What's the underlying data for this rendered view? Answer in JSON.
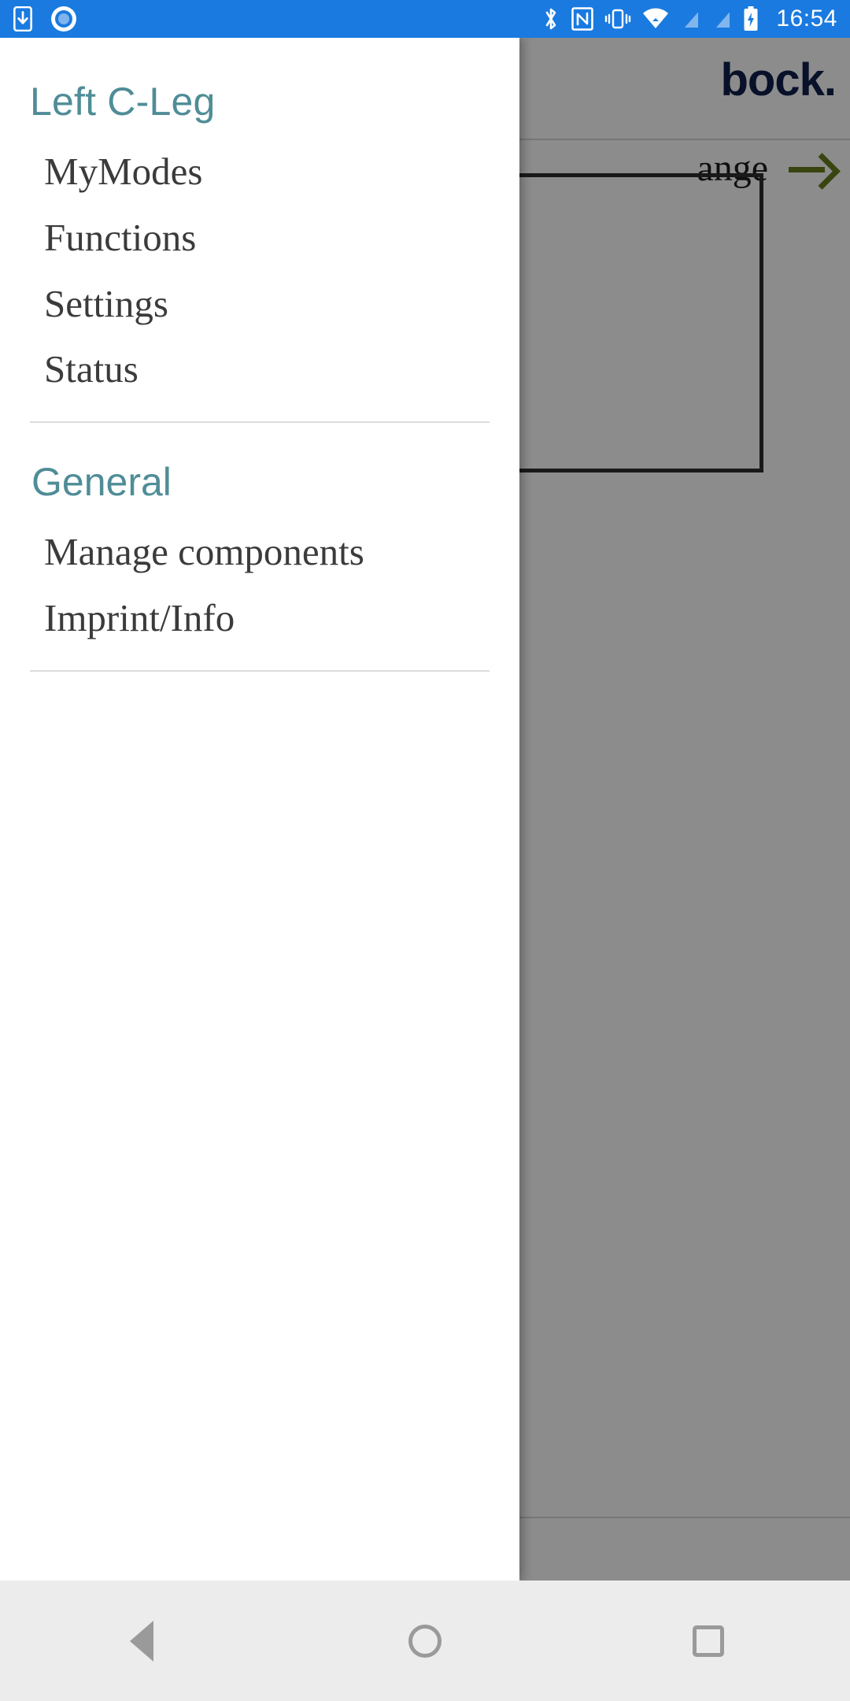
{
  "status_bar": {
    "background_color": "#1a7ae0",
    "clock": "16:54",
    "left_icons": [
      {
        "name": "app-download-icon",
        "label": "download to device"
      },
      {
        "name": "record-ring-icon",
        "label": "recording indicator"
      }
    ],
    "right_icons": [
      {
        "name": "bluetooth-icon",
        "label": "Bluetooth"
      },
      {
        "name": "nfc-icon",
        "label": "NFC"
      },
      {
        "name": "vibrate-icon",
        "label": "Vibrate"
      },
      {
        "name": "wifi-icon",
        "label": "Wi-Fi"
      },
      {
        "name": "signal-off-icon",
        "label": "No SIM 1"
      },
      {
        "name": "signal-off-icon-2",
        "label": "No SIM 2"
      },
      {
        "name": "battery-charging-icon",
        "label": "Charging"
      }
    ]
  },
  "drawer": {
    "title": "Left C-Leg",
    "title_color": "#4f8d97",
    "items": [
      {
        "label": "MyModes"
      },
      {
        "label": "Functions"
      },
      {
        "label": "Settings"
      },
      {
        "label": "Status"
      }
    ],
    "section": {
      "title": "General",
      "items": [
        {
          "label": "Manage components"
        },
        {
          "label": "Imprint/Info"
        }
      ]
    }
  },
  "background_app": {
    "logo_text": "bock.",
    "logo_color": "#10204b",
    "change_row_label": "ange",
    "change_arrow_color": "#667f1c",
    "bottom_icon": "broadcast-signal-icon"
  },
  "nav_bar": {
    "background_color": "#ececec",
    "buttons": [
      {
        "name": "back",
        "label": "Back"
      },
      {
        "name": "home",
        "label": "Home"
      },
      {
        "name": "recents",
        "label": "Recents"
      }
    ]
  }
}
